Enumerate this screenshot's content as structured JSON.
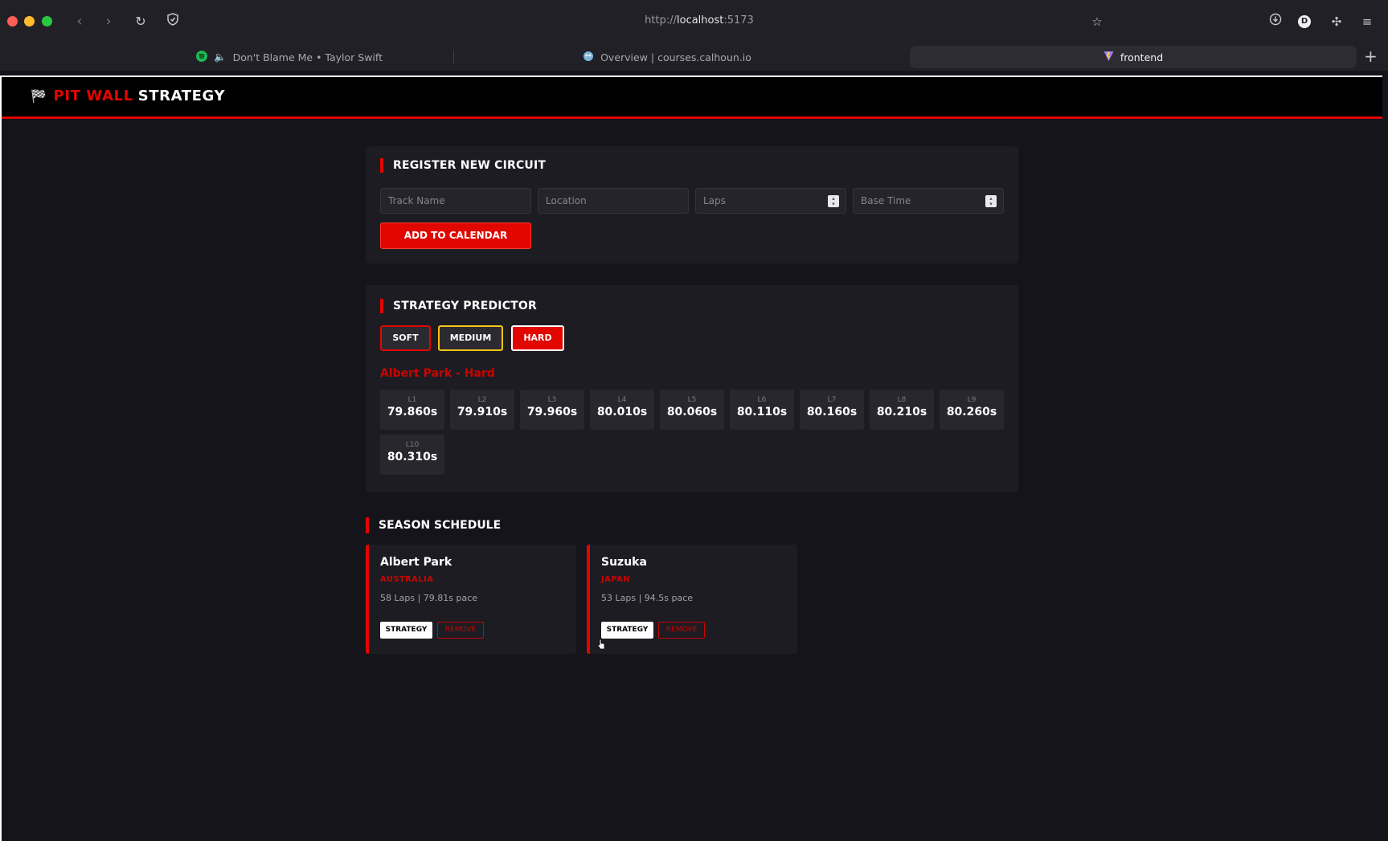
{
  "browser": {
    "url_scheme": "http://",
    "url_host": "localhost",
    "url_port": ":5173",
    "profile_initial": "D",
    "tabs": [
      {
        "label": "Don't Blame Me • Taylor Swift",
        "icon": "spotify-icon",
        "audio": true
      },
      {
        "label": "Overview | courses.calhoun.io",
        "icon": "gopher-icon"
      },
      {
        "label": "frontend",
        "icon": "vite-icon",
        "active": true
      }
    ]
  },
  "app": {
    "brand_red": "PIT WALL",
    "brand_white": "STRATEGY",
    "accent_color": "#e10600"
  },
  "register": {
    "title": "REGISTER NEW CIRCUIT",
    "track_placeholder": "Track Name",
    "location_placeholder": "Location",
    "laps_placeholder": "Laps",
    "base_time_placeholder": "Base Time",
    "add_label": "ADD TO CALENDAR"
  },
  "predictor": {
    "title": "STRATEGY PREDICTOR",
    "compounds": [
      "SOFT",
      "MEDIUM",
      "HARD"
    ],
    "selected_compound": "HARD",
    "strategy_title": "Albert Park - Hard",
    "laps": [
      {
        "lap": "L1",
        "time": "79.860s"
      },
      {
        "lap": "L2",
        "time": "79.910s"
      },
      {
        "lap": "L3",
        "time": "79.960s"
      },
      {
        "lap": "L4",
        "time": "80.010s"
      },
      {
        "lap": "L5",
        "time": "80.060s"
      },
      {
        "lap": "L6",
        "time": "80.110s"
      },
      {
        "lap": "L7",
        "time": "80.160s"
      },
      {
        "lap": "L8",
        "time": "80.210s"
      },
      {
        "lap": "L9",
        "time": "80.260s"
      },
      {
        "lap": "L10",
        "time": "80.310s"
      }
    ]
  },
  "schedule": {
    "title": "SEASON SCHEDULE",
    "strategy_label": "STRATEGY",
    "remove_label": "REMOVE",
    "circuits": [
      {
        "name": "Albert Park",
        "location": "AUSTRALIA",
        "stats": "58 Laps | 79.81s pace"
      },
      {
        "name": "Suzuka",
        "location": "JAPAN",
        "stats": "53 Laps | 94.5s pace"
      }
    ]
  }
}
